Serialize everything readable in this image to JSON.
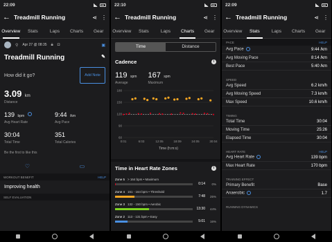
{
  "panels": [
    {
      "time": "22:09"
    },
    {
      "time": "22:10"
    },
    {
      "time": "22:09"
    }
  ],
  "title": "Treadmill Running",
  "tabs": {
    "p1": [
      "Overview",
      "Stats",
      "Laps",
      "Charts",
      "Gear"
    ],
    "p2": [
      "Overview",
      "Stats",
      "Laps",
      "Charts",
      "Gear"
    ],
    "p3": [
      "Overview",
      "Stats",
      "Laps",
      "Charts",
      "Gear"
    ]
  },
  "overview": {
    "date": "Apr 27 @ 08:35",
    "activity": "Treadmill Running",
    "question": "How did it go?",
    "add_note": "Add Note",
    "distance": "3.09",
    "distance_unit": "km",
    "distance_label": "Distance",
    "hr": "139",
    "hr_unit": "bpm",
    "hr_label": "Avg Heart Rate",
    "pace": "9:44",
    "pace_unit": "/km",
    "pace_label": "Avg Pace",
    "time": "30:04",
    "time_label": "Total Time",
    "calories": "351",
    "calories_label": "Total Calories",
    "like": "Be the first to like this",
    "workout_benefit": "WORKOUT BENEFIT",
    "help": "HELP",
    "benefit": "Improving health",
    "self_eval": "SELF EVALUATION"
  },
  "charts": {
    "seg_time": "Time",
    "seg_distance": "Distance",
    "cadence_title": "Cadence",
    "avg": "119",
    "avg_unit": "spm",
    "avg_label": "Average",
    "max": "167",
    "max_unit": "spm",
    "max_label": "Maximum",
    "xlabel": "Time (h:m:s)",
    "zones_title": "Time in Heart Rate Zones",
    "zones": [
      {
        "name": "Zone 5",
        "range": "> 164 bpm • Maximum",
        "time": "0:14",
        "pct": "0%",
        "frac": 0.01,
        "color": "#d0021b"
      },
      {
        "name": "Zone 4",
        "range": "151 - 164 bpm • Threshold",
        "time": "7:48",
        "pct": "25%",
        "frac": 0.25,
        "color": "#f5a623"
      },
      {
        "name": "Zone 3",
        "range": "132 - 150 bpm • Aerobic",
        "time": "13:30",
        "pct": "44%",
        "frac": 0.44,
        "color": "#7ed321"
      },
      {
        "name": "Zone 2",
        "range": "113 - 131 bpm • Easy",
        "time": "5:01",
        "pct": "16%",
        "frac": 0.16,
        "color": "#4a90e2"
      }
    ]
  },
  "chart_data": {
    "type": "scatter",
    "title": "Cadence",
    "xlabel": "Time (h:m:s)",
    "ylabel": "",
    "x_ticks": [
      "0:01",
      "6:03",
      "12:05",
      "18:09",
      "24:05",
      "30:04"
    ],
    "y_ticks": [
      180,
      150,
      120,
      90,
      60
    ],
    "ylim": [
      60,
      180
    ],
    "average_line": 119,
    "series": [
      {
        "values": [
          {
            "x": 0,
            "y": 119
          },
          {
            "x": 1,
            "y": 120
          },
          {
            "x": 2,
            "y": 122
          },
          {
            "x": 3,
            "y": 158
          },
          {
            "x": 4,
            "y": 160
          },
          {
            "x": 5,
            "y": 121
          },
          {
            "x": 6,
            "y": 120
          },
          {
            "x": 7,
            "y": 159
          },
          {
            "x": 8,
            "y": 156
          },
          {
            "x": 9,
            "y": 122
          },
          {
            "x": 10,
            "y": 160
          },
          {
            "x": 11,
            "y": 158
          },
          {
            "x": 12,
            "y": 121
          },
          {
            "x": 13,
            "y": 120
          },
          {
            "x": 14,
            "y": 160
          },
          {
            "x": 15,
            "y": 162
          },
          {
            "x": 16,
            "y": 120
          },
          {
            "x": 17,
            "y": 157
          },
          {
            "x": 18,
            "y": 158
          },
          {
            "x": 19,
            "y": 123
          },
          {
            "x": 20,
            "y": 122
          },
          {
            "x": 21,
            "y": 159
          },
          {
            "x": 22,
            "y": 161
          },
          {
            "x": 23,
            "y": 121
          },
          {
            "x": 24,
            "y": 120
          },
          {
            "x": 25,
            "y": 158
          },
          {
            "x": 26,
            "y": 160
          },
          {
            "x": 27,
            "y": 122
          },
          {
            "x": 28,
            "y": 121
          },
          {
            "x": 29,
            "y": 155
          },
          {
            "x": 30,
            "y": 119
          }
        ]
      }
    ]
  },
  "stats": {
    "help": "HELP",
    "sections": [
      {
        "title": "PACE",
        "help": true,
        "rows": [
          [
            "Avg Pace",
            "9:44 /km"
          ],
          [
            "Avg Moving Pace",
            "8:14 /km"
          ],
          [
            "Best Pace",
            "5:40 /km"
          ]
        ]
      },
      {
        "title": "SPEED",
        "help": false,
        "rows": [
          [
            "Avg Speed",
            "6.2 km/h"
          ],
          [
            "Avg Moving Speed",
            "7.3 km/h"
          ],
          [
            "Max Speed",
            "10.6 km/h"
          ]
        ]
      },
      {
        "title": "TIMING",
        "help": false,
        "rows": [
          [
            "Total Time",
            "30:04"
          ],
          [
            "Moving Time",
            "25:26"
          ],
          [
            "Elapsed Time",
            "30:04"
          ]
        ]
      },
      {
        "title": "HEART RATE",
        "help": true,
        "rows": [
          [
            "Avg Heart Rate",
            "139 bpm"
          ],
          [
            "Max Heart Rate",
            "170 bpm"
          ]
        ]
      },
      {
        "title": "TRAINING EFFECT",
        "help": false,
        "rows": [
          [
            "Primary Benefit",
            "Base"
          ],
          [
            "Anaerobic",
            "1.7"
          ]
        ]
      },
      {
        "title": "RUNNING DYNAMICS",
        "help": false,
        "rows": []
      }
    ]
  }
}
